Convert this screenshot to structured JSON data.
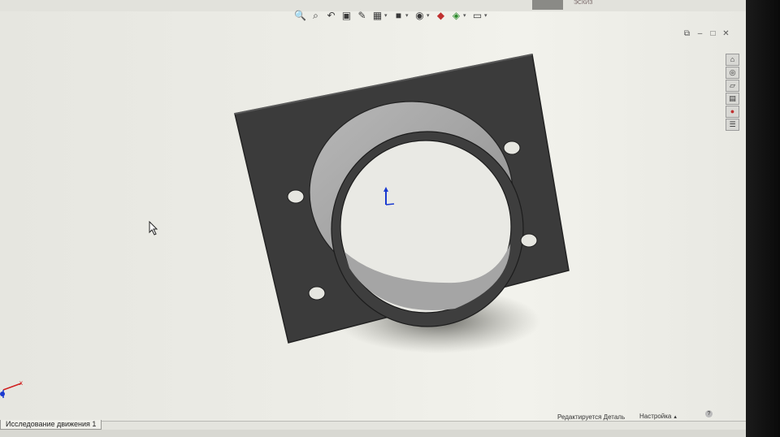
{
  "window": {
    "top_tab_text": "ЭСКИЗ",
    "controls": [
      "restore-pane",
      "minimize",
      "restore",
      "close"
    ]
  },
  "heads_up_toolbar": {
    "icons": [
      "zoom-to-fit-icon",
      "zoom-area-icon",
      "previous-view-icon",
      "section-view-icon",
      "dynamic-annotation-icon",
      "view-orientation-icon",
      "display-style-icon",
      "hide-show-items-icon",
      "edit-appearance-icon",
      "apply-scene-icon",
      "view-settings-icon"
    ]
  },
  "task_pane": {
    "icons": [
      "home-icon",
      "design-library-icon",
      "file-explorer-icon",
      "view-palette-icon",
      "appearances-icon",
      "custom-properties-icon"
    ]
  },
  "tabs": {
    "motion_study": "Исследование движения 1"
  },
  "status": {
    "editing": "Редактируется Деталь",
    "settings": "Настройка"
  },
  "colors": {
    "plate": "#3b3b3b",
    "bore_wall": "#a3a3a3",
    "viewport_bg": "#ececE6",
    "axis_blue": "#1a3ad0",
    "axis_red": "#d02020"
  }
}
